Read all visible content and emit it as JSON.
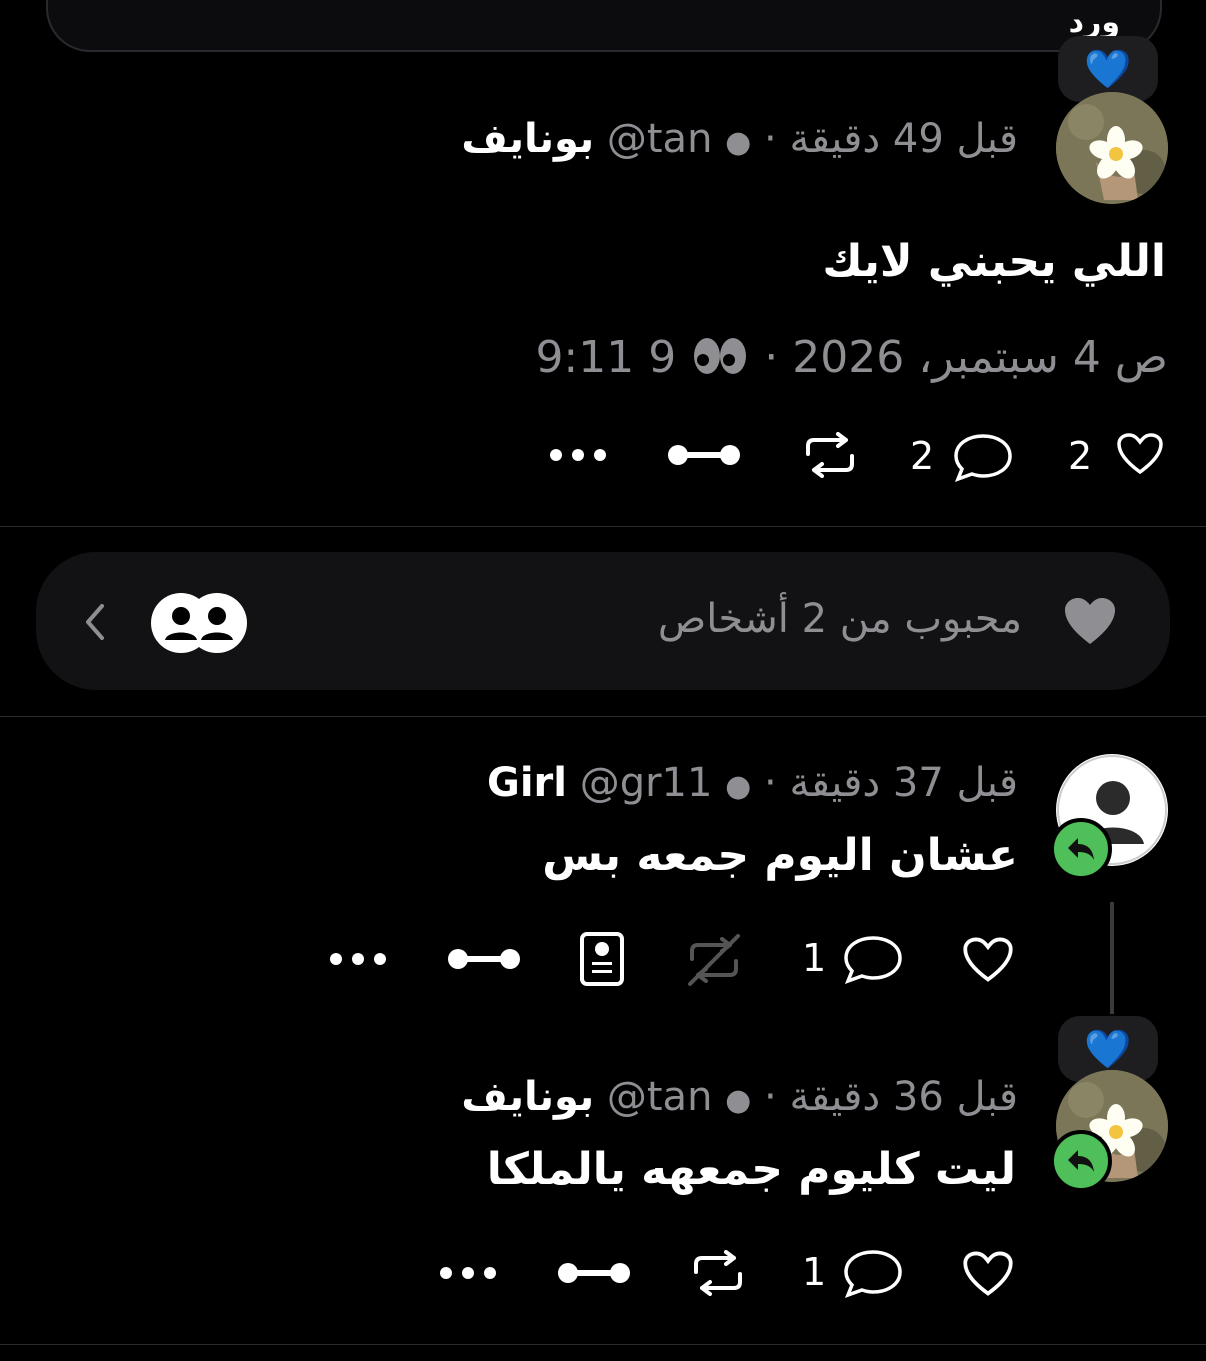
{
  "top_pill": {
    "text": "ورد"
  },
  "post": {
    "badge_emoji": "💙",
    "name": "بونايف",
    "handle": "@tan",
    "flame": "🔥",
    "separator": "·",
    "time_ago": "قبل 49 دقيقة",
    "text": "اللي يحبني لايك",
    "timestamp": "9:11 ص 4 سبتمبر، 2026",
    "views_separator": "·",
    "views_icon": "eyes-icon",
    "views_count": "9",
    "likes": "2",
    "replies": "2"
  },
  "liked_by": {
    "text": "محبوب من 2 أشخاص"
  },
  "reply1": {
    "name": "Girl",
    "handle": "@gr11",
    "separator": "·",
    "time_ago": "قبل 37 دقيقة",
    "text": "عشان اليوم جمعه بس",
    "replies": "1"
  },
  "reply2": {
    "badge_emoji": "💙",
    "name": "بونايف",
    "handle": "@tan",
    "separator": "·",
    "time_ago": "قبل 36 دقيقة",
    "text": "ليت كليوم جمعهه يالملكا",
    "replies": "1"
  },
  "colors": {
    "background": "#000000",
    "muted": "#8e8e93",
    "reply_badge": "#4fbf5a",
    "heart_badge": "#2f6fe0"
  }
}
